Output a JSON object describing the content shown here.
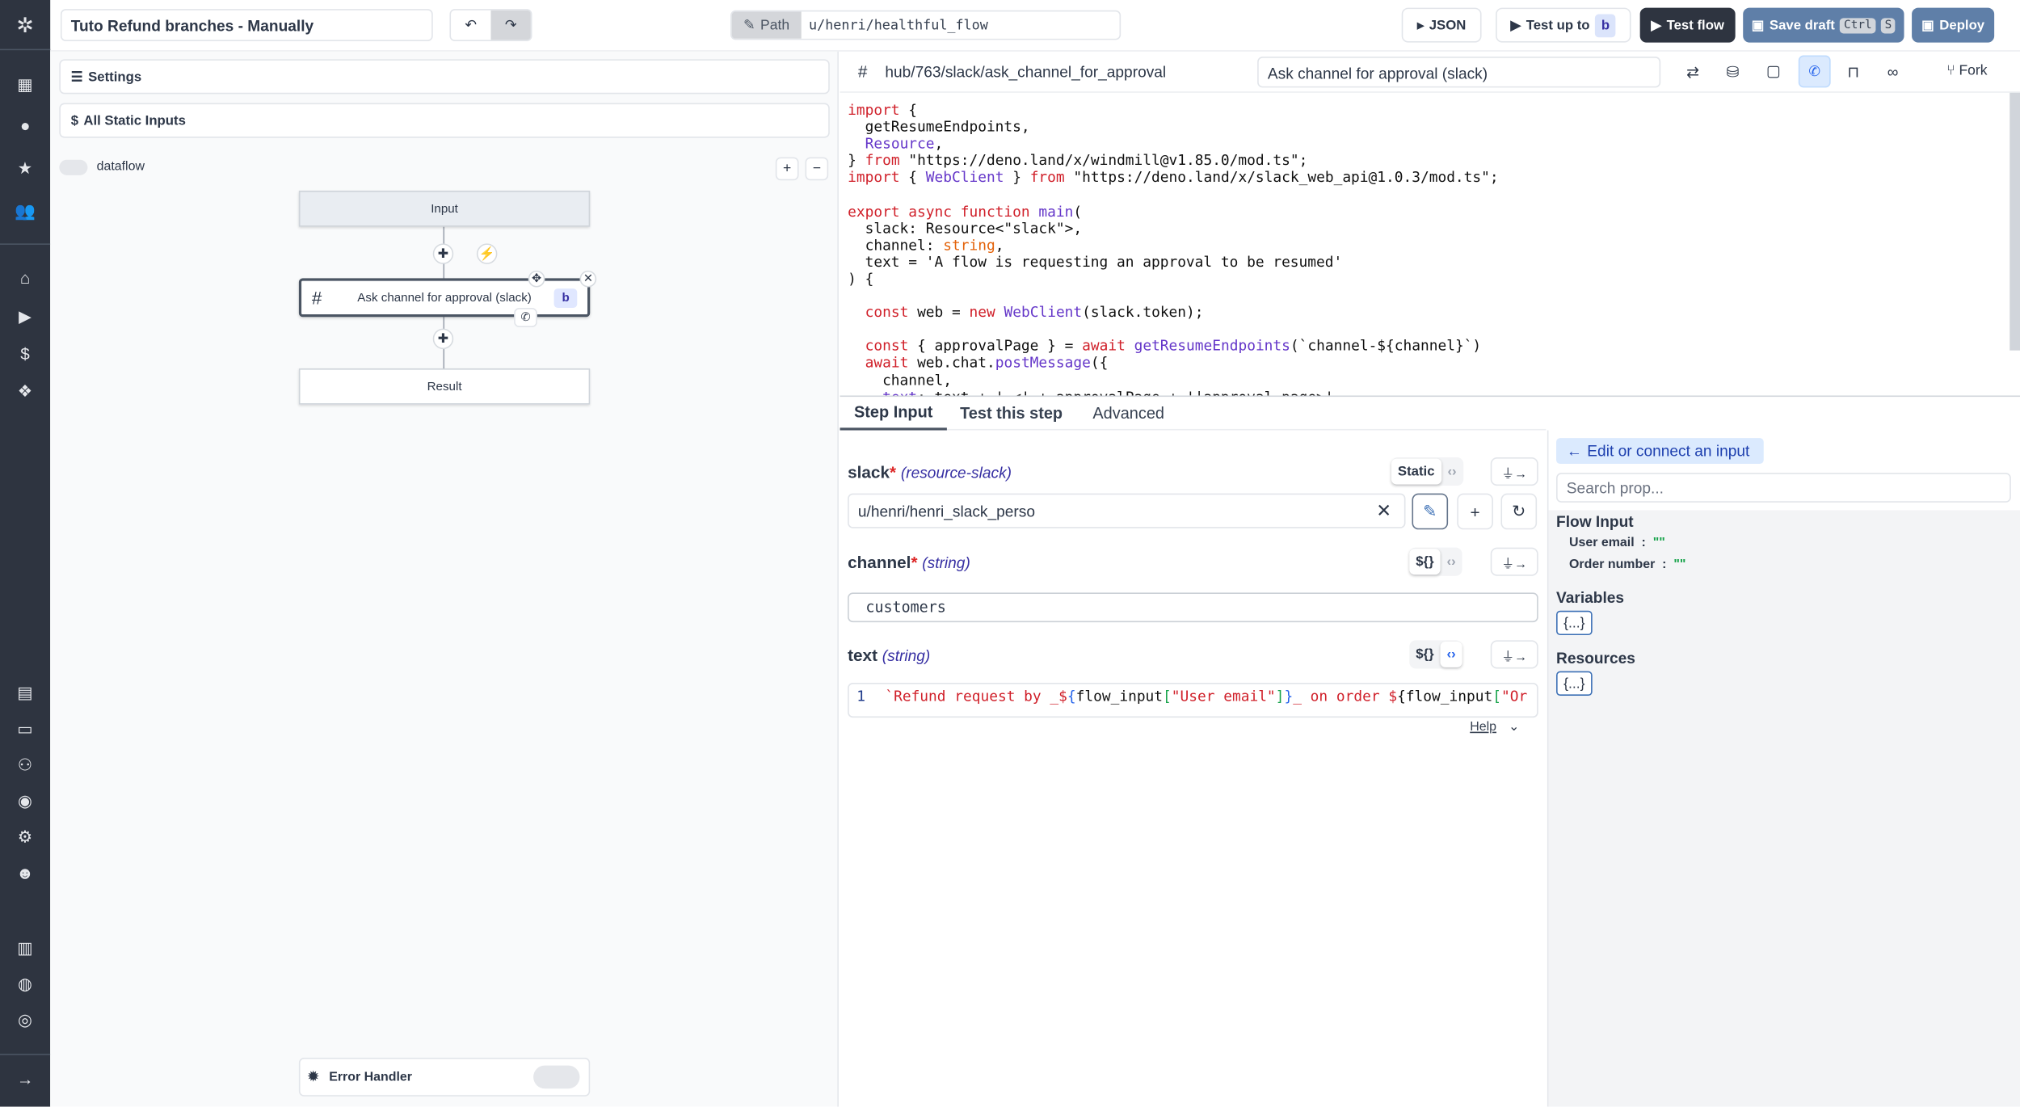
{
  "header": {
    "flow_title": "Tuto Refund branches - Manually",
    "undo_icon": "undo-icon",
    "redo_icon": "redo-icon",
    "path_label": "Path",
    "path_value": "u/henri/healthful_flow",
    "json_label": "JSON",
    "test_up_to_label": "Test up to",
    "test_up_to_step": "b",
    "test_flow_label": "Test flow",
    "save_draft_label": "Save draft",
    "save_shortcut": [
      "Ctrl",
      "S"
    ],
    "deploy_label": "Deploy"
  },
  "left": {
    "settings_label": "Settings",
    "static_inputs_label": "All Static Inputs",
    "dataflow_label": "dataflow",
    "nodes": {
      "input": "Input",
      "step": "Ask channel for approval (slack)",
      "step_id": "b",
      "result": "Result"
    },
    "error_handler_label": "Error Handler"
  },
  "editor": {
    "script_path": "hub/763/slack/ask_channel_for_approval",
    "summary": "Ask channel for approval (slack)",
    "fork_label": "Fork"
  },
  "tabs": [
    "Step Input",
    "Test this step",
    "Advanced"
  ],
  "inputs": {
    "slack": {
      "name": "slack",
      "required": "*",
      "type": "(resource-slack)",
      "mode": "Static",
      "value": "u/henri/henri_slack_perso"
    },
    "channel": {
      "name": "channel",
      "required": "*",
      "type": "(string)",
      "mode": "${}",
      "value": "customers"
    },
    "text": {
      "name": "text",
      "type": "(string)",
      "mode": "${}",
      "line_no": "1",
      "help": "Help"
    }
  },
  "connect": {
    "title": "Edit or connect an input",
    "search_placeholder": "Search prop...",
    "flow_input_title": "Flow Input",
    "flow_inputs": [
      {
        "key": "User email",
        "value": "\"\""
      },
      {
        "key": "Order number",
        "value": "\"\""
      }
    ],
    "variables_title": "Variables",
    "resources_title": "Resources",
    "obj": "{...}"
  },
  "colors": {
    "sidebar": "#2e3440",
    "test_flow": "#2e3440",
    "save": "#5f7fa8",
    "link": "#3730a3"
  }
}
